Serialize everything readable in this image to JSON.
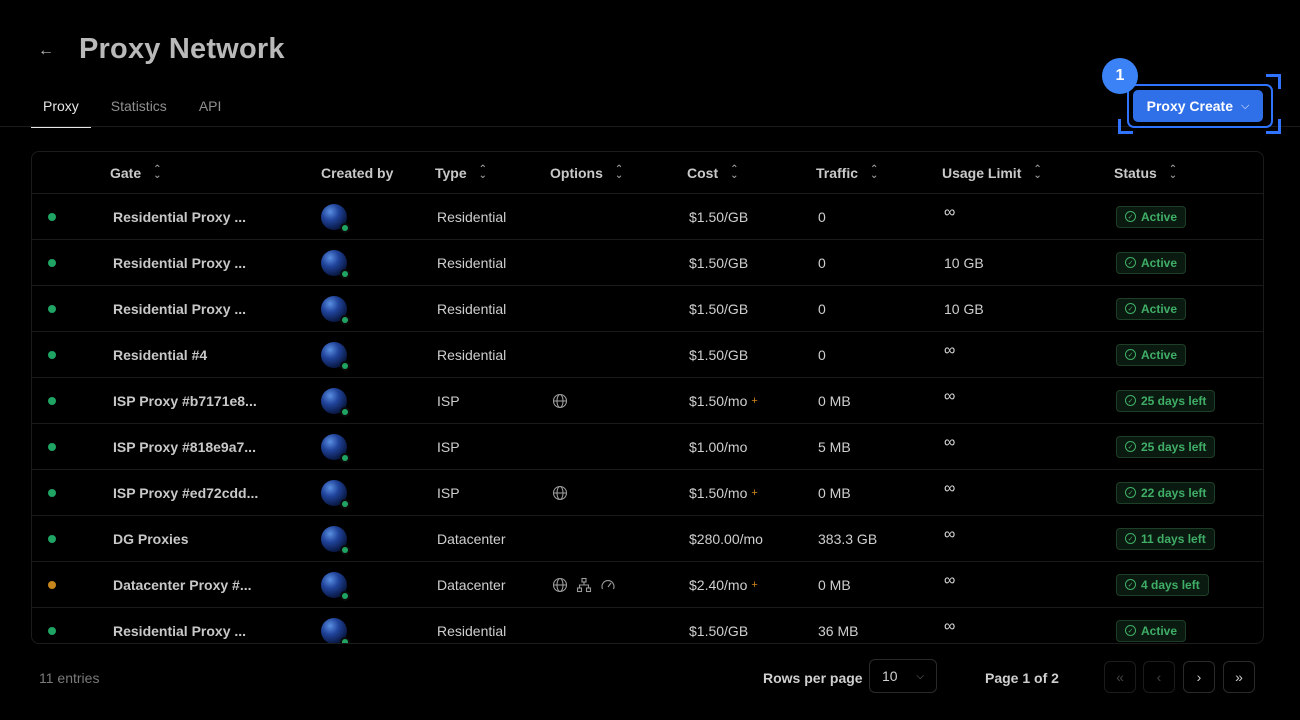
{
  "header": {
    "back_icon": "arrow-left-icon",
    "title": "Proxy Network",
    "tabs": [
      "Proxy",
      "Statistics",
      "API"
    ],
    "active_tab": "Proxy",
    "create_button": "Proxy Create",
    "step_badge": "1"
  },
  "table": {
    "columns": [
      "Gate",
      "Created by",
      "Type",
      "Options",
      "Cost",
      "Traffic",
      "Usage Limit",
      "Status"
    ],
    "rows": [
      {
        "gate": "Residential Proxy ...",
        "type": "Residential",
        "options": [],
        "cost": "$1.50/GB",
        "plus": false,
        "traffic": "0",
        "limit": "∞",
        "status": "Active",
        "dot": "green"
      },
      {
        "gate": "Residential Proxy ...",
        "type": "Residential",
        "options": [],
        "cost": "$1.50/GB",
        "plus": false,
        "traffic": "0",
        "limit": "10 GB",
        "status": "Active",
        "dot": "green"
      },
      {
        "gate": "Residential Proxy ...",
        "type": "Residential",
        "options": [],
        "cost": "$1.50/GB",
        "plus": false,
        "traffic": "0",
        "limit": "10 GB",
        "status": "Active",
        "dot": "green"
      },
      {
        "gate": "Residential #4",
        "type": "Residential",
        "options": [],
        "cost": "$1.50/GB",
        "plus": false,
        "traffic": "0",
        "limit": "∞",
        "status": "Active",
        "dot": "green"
      },
      {
        "gate": "ISP Proxy #b7171e8...",
        "type": "ISP",
        "options": [
          "globe-icon"
        ],
        "cost": "$1.50/mo",
        "plus": true,
        "traffic": "0 MB",
        "limit": "∞",
        "status": "25 days left",
        "dot": "green"
      },
      {
        "gate": "ISP Proxy #818e9a7...",
        "type": "ISP",
        "options": [],
        "cost": "$1.00/mo",
        "plus": false,
        "traffic": "5 MB",
        "limit": "∞",
        "status": "25 days left",
        "dot": "green"
      },
      {
        "gate": "ISP Proxy #ed72cdd...",
        "type": "ISP",
        "options": [
          "globe-icon"
        ],
        "cost": "$1.50/mo",
        "plus": true,
        "traffic": "0 MB",
        "limit": "∞",
        "status": "22 days left",
        "dot": "green"
      },
      {
        "gate": "DG Proxies",
        "type": "Datacenter",
        "options": [],
        "cost": "$280.00/mo",
        "plus": false,
        "traffic": "383.3 GB",
        "limit": "∞",
        "status": "11 days left",
        "dot": "green"
      },
      {
        "gate": "Datacenter Proxy #...",
        "type": "Datacenter",
        "options": [
          "globe-icon",
          "network-icon",
          "speedometer-icon"
        ],
        "cost": "$2.40/mo",
        "plus": true,
        "traffic": "0 MB",
        "limit": "∞",
        "status": "4 days left",
        "dot": "orange"
      },
      {
        "gate": "Residential Proxy ...",
        "type": "Residential",
        "options": [],
        "cost": "$1.50/GB",
        "plus": false,
        "traffic": "36 MB",
        "limit": "∞",
        "status": "Active",
        "dot": "green"
      }
    ]
  },
  "footer": {
    "entries": "11 entries",
    "rows_per_page_label": "Rows per page",
    "rows_per_page_value": "10",
    "page_info": "Page 1 of 2"
  },
  "colors": {
    "accent": "#2f6fe8",
    "status_green": "#3fae67",
    "dot_green": "#1fa463",
    "dot_orange": "#c7861b"
  }
}
